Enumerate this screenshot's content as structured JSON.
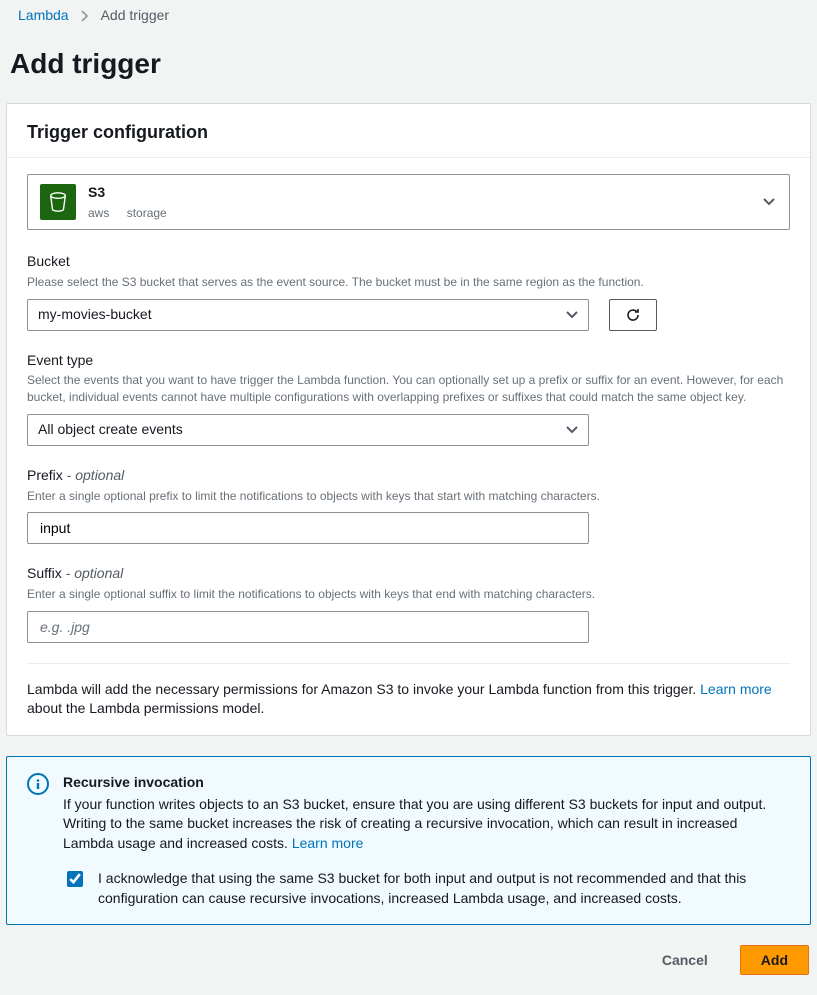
{
  "breadcrumb": {
    "root": "Lambda",
    "current": "Add trigger"
  },
  "page_title": "Add trigger",
  "panel": {
    "title": "Trigger configuration",
    "source": {
      "title": "S3",
      "tag1": "aws",
      "tag2": "storage"
    },
    "bucket": {
      "label": "Bucket",
      "hint": "Please select the S3 bucket that serves as the event source. The bucket must be in the same region as the function.",
      "value": "my-movies-bucket"
    },
    "event_type": {
      "label": "Event type",
      "hint": "Select the events that you want to have trigger the Lambda function. You can optionally set up a prefix or suffix for an event. However, for each bucket, individual events cannot have multiple configurations with overlapping prefixes or suffixes that could match the same object key.",
      "value": "All object create events"
    },
    "prefix": {
      "label": "Prefix",
      "optional": " - optional",
      "hint": "Enter a single optional prefix to limit the notifications to objects with keys that start with matching characters.",
      "value": "input"
    },
    "suffix": {
      "label": "Suffix",
      "optional": " - optional",
      "hint": "Enter a single optional suffix to limit the notifications to objects with keys that end with matching characters.",
      "placeholder": "e.g. .jpg",
      "value": ""
    },
    "permissions": {
      "text1": "Lambda will add the necessary permissions for Amazon S3 to invoke your Lambda function from this trigger. ",
      "link": "Learn more",
      "text2": " about the Lambda permissions model."
    }
  },
  "info": {
    "title": "Recursive invocation",
    "text1": "If your function writes objects to an S3 bucket, ensure that you are using different S3 buckets for input and output. Writing to the same bucket increases the risk of creating a recursive invocation, which can result in increased Lambda usage and increased costs. ",
    "link": "Learn more",
    "ack": "I acknowledge that using the same S3 bucket for both input and output is not recommended and that this configuration can cause recursive invocations, increased Lambda usage, and increased costs."
  },
  "buttons": {
    "cancel": "Cancel",
    "add": "Add"
  }
}
